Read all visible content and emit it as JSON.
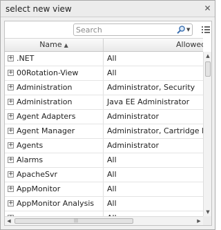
{
  "dialog": {
    "title": "select new view",
    "close_symbol": "✕"
  },
  "toolbar": {
    "search_placeholder": "Search",
    "search_icon": "search-icon",
    "columns_icon": "column-chooser-icon"
  },
  "table": {
    "columns": [
      {
        "label": "Name",
        "sort": "ascending"
      },
      {
        "label": "Allowed"
      }
    ],
    "rows": [
      {
        "name": ".NET",
        "allowed": "All"
      },
      {
        "name": "00Rotation-View",
        "allowed": "All"
      },
      {
        "name": "Administration",
        "allowed": "Administrator, Security"
      },
      {
        "name": "Administration",
        "allowed": "Java EE Administrator"
      },
      {
        "name": "Agent Adapters",
        "allowed": "Administrator"
      },
      {
        "name": "Agent Manager",
        "allowed": "Administrator, Cartridge Dev"
      },
      {
        "name": "Agents",
        "allowed": "Administrator"
      },
      {
        "name": "Alarms",
        "allowed": "All"
      },
      {
        "name": "ApacheSvr",
        "allowed": "All"
      },
      {
        "name": "AppMonitor",
        "allowed": "All"
      },
      {
        "name": "AppMonitor Analysis",
        "allowed": "All"
      },
      {
        "name": "",
        "allowed": "All"
      }
    ]
  },
  "scrollbars": {
    "grip": "|||",
    "vertical_position": 0.0,
    "horizontal_position": 0.0
  },
  "colors": {
    "dialog_bg": "#f0f0f0",
    "panel_bg": "#ffffff",
    "border": "#c2c2c2"
  }
}
